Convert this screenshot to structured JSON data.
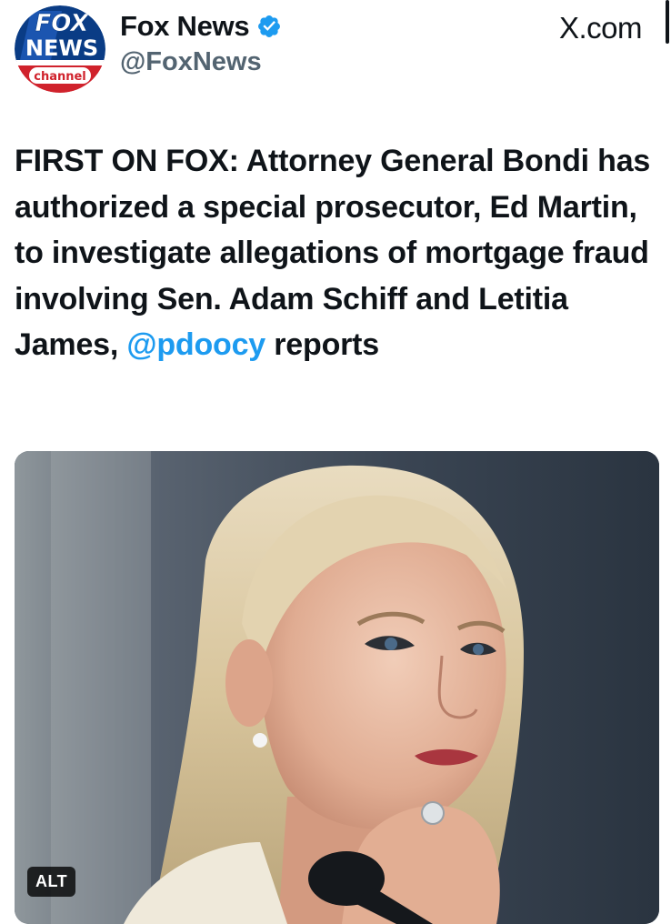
{
  "account": {
    "display_name": "Fox News",
    "handle": "@FoxNews",
    "verified": true,
    "avatar_logo": {
      "line1": "FOX",
      "line2": "NEWS",
      "line3": "channel"
    }
  },
  "source_label": "X.com",
  "post": {
    "text_before_mention": "FIRST ON FOX: Attorney General Bondi has authorized a special prosecutor, Ed Martin, to investigate allegations of mortgage fraud involving Sen. Adam Schiff and Letitia James, ",
    "mention": "@pdoocy",
    "text_after_mention": " reports"
  },
  "media": {
    "alt_badge": "ALT"
  },
  "colors": {
    "accent": "#1d9bf0",
    "text": "#0f1419",
    "secondary": "#536471"
  },
  "icons": {
    "verified": "verified-badge-icon",
    "avatar": "fox-news-channel-logo"
  }
}
